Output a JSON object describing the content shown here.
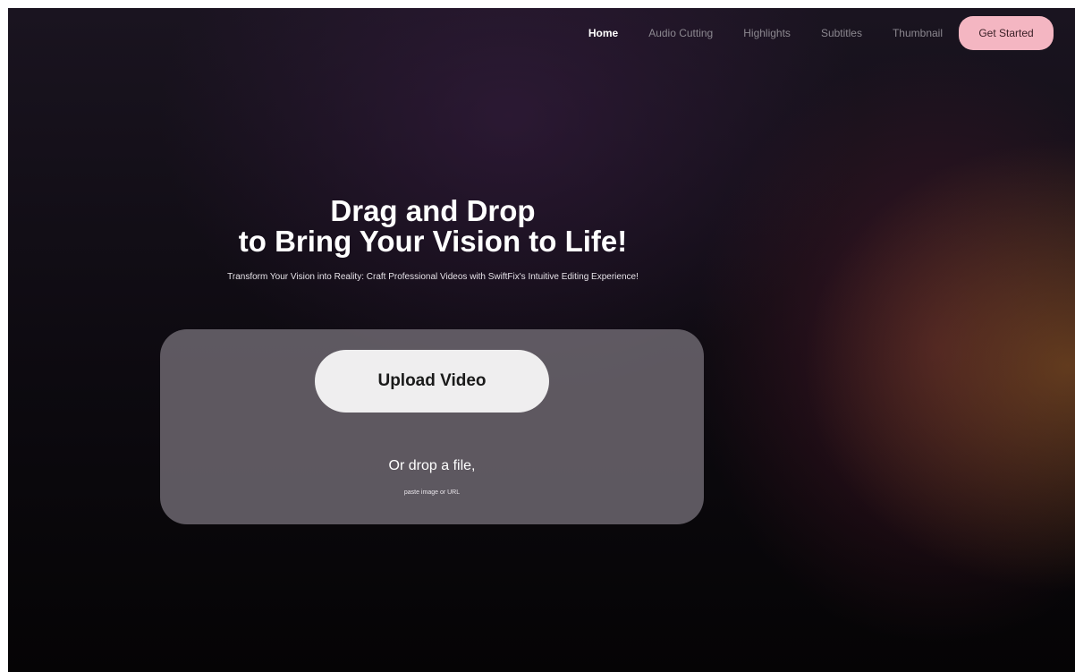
{
  "nav": {
    "items": [
      {
        "label": "Home",
        "active": true
      },
      {
        "label": "Audio Cutting",
        "active": false
      },
      {
        "label": "Highlights",
        "active": false
      },
      {
        "label": "Subtitles",
        "active": false
      },
      {
        "label": "Thumbnail",
        "active": false
      }
    ],
    "cta_label": "Get Started"
  },
  "hero": {
    "title_line1": "Drag and Drop",
    "title_line2": "to Bring Your Vision to Life!",
    "subtitle": "Transform Your Vision into Reality: Craft Professional Videos with SwiftFix's Intuitive Editing Experience!"
  },
  "upload": {
    "button_label": "Upload Video",
    "drop_text": "Or drop a file,",
    "drop_subtext": "paste image or URL"
  },
  "colors": {
    "cta_background": "#f4b6c2",
    "panel_background": "#6f6a73",
    "page_background": "#0d0a10"
  }
}
